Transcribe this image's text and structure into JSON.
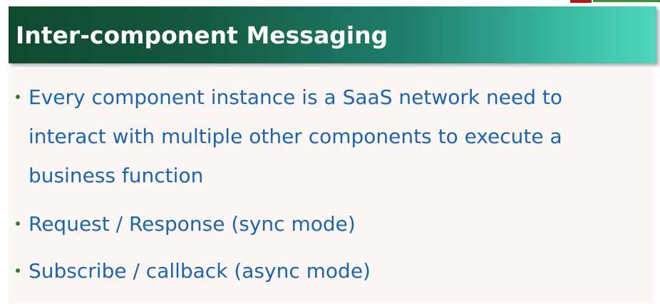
{
  "slide": {
    "title": "Inter-component Messaging",
    "bullets": [
      {
        "lines": [
          "Every component instance is a SaaS network need to",
          "interact with multiple other components to execute a",
          "business function"
        ]
      },
      {
        "lines": [
          "Request / Response (sync mode)"
        ]
      },
      {
        "lines": [
          "Subscribe / callback (async mode)"
        ]
      }
    ]
  },
  "colors": {
    "title_banner_start": "#0f4a2e",
    "title_banner_end": "#4fd6bd",
    "title_text": "#ffffff",
    "bullet_text": "#1a64b0",
    "bullet_marker": "#2e7a3a",
    "content_background": "#fcf7f4"
  }
}
